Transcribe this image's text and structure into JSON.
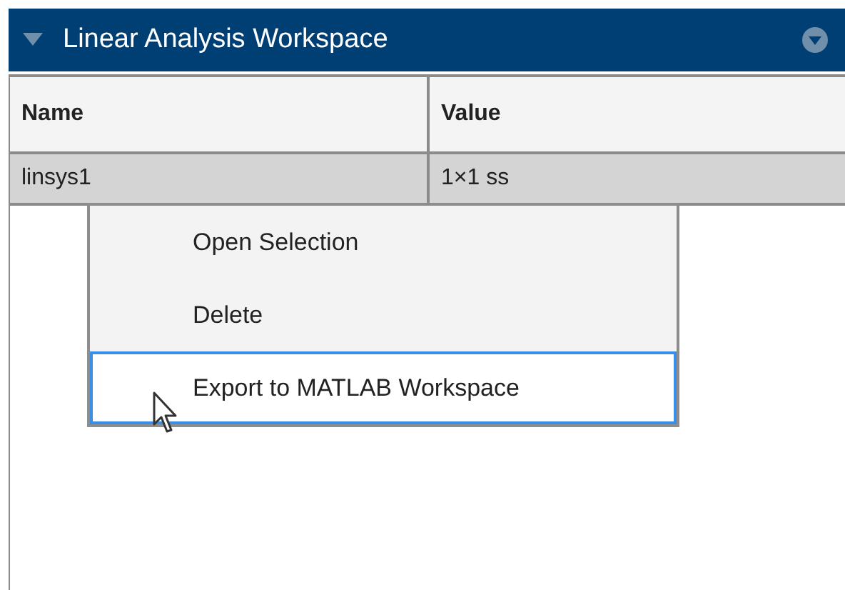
{
  "panel": {
    "title": "Linear Analysis Workspace",
    "expanded": true
  },
  "table": {
    "columns": [
      "Name",
      "Value"
    ],
    "rows": [
      {
        "cells": [
          "linsys1",
          "1×1 ss"
        ],
        "selected": true
      }
    ]
  },
  "context_menu": {
    "items": [
      {
        "label": "Open Selection",
        "selected": false
      },
      {
        "label": "Delete",
        "selected": false
      },
      {
        "label": "Export to MATLAB Workspace",
        "selected": true
      }
    ]
  }
}
